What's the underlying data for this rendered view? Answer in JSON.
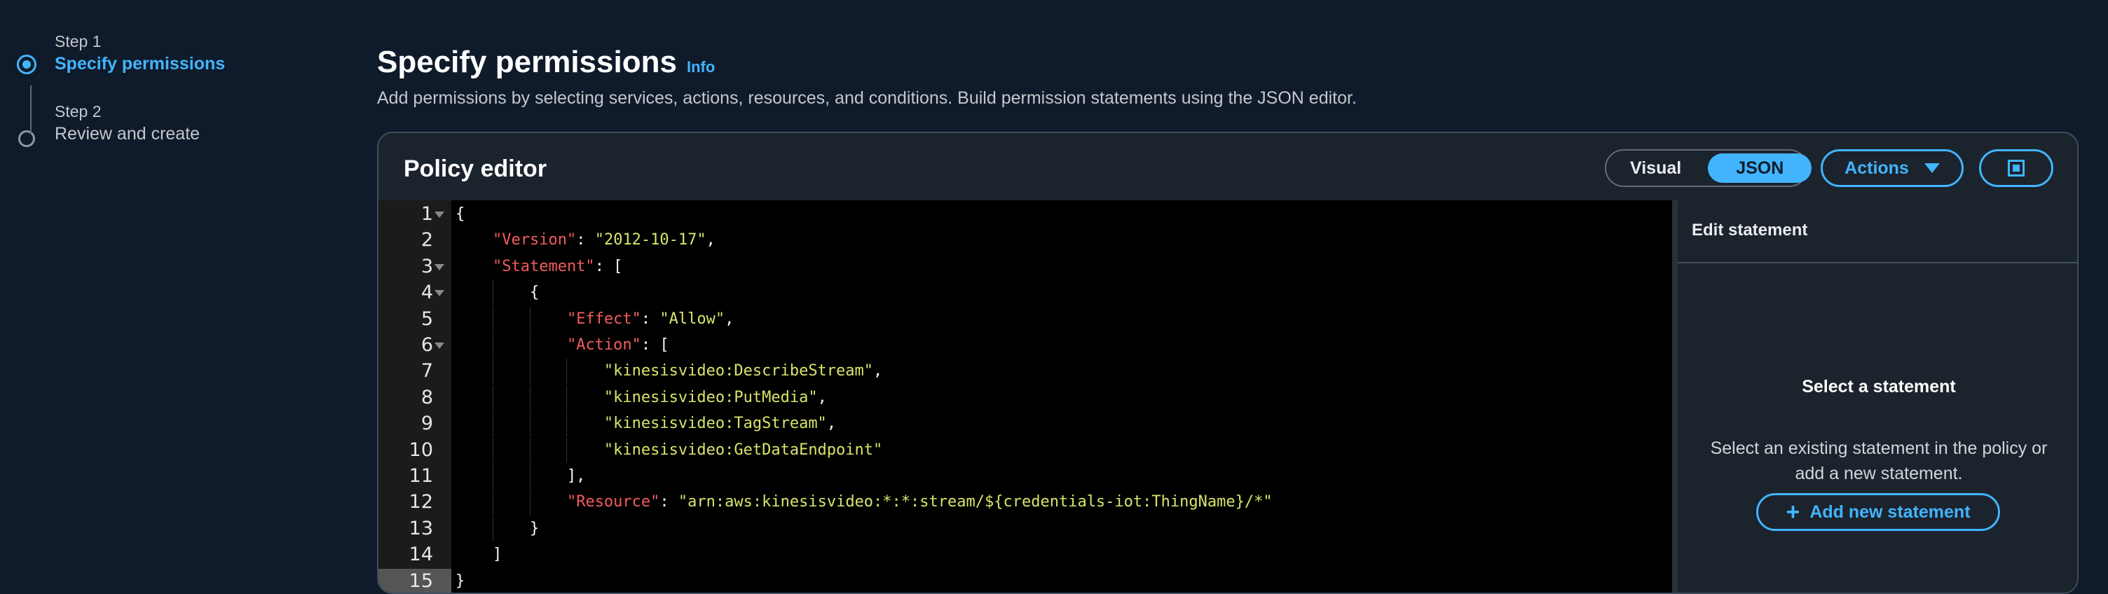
{
  "steps": [
    {
      "sub": "Step 1",
      "title": "Specify permissions",
      "active": true
    },
    {
      "sub": "Step 2",
      "title": "Review and create",
      "active": false
    }
  ],
  "header": {
    "title": "Specify permissions",
    "info": "Info",
    "description": "Add permissions by selecting services, actions, resources, and conditions. Build permission statements using the JSON editor."
  },
  "editor": {
    "title": "Policy editor",
    "mode_options": [
      "Visual",
      "JSON"
    ],
    "selected_mode": "JSON",
    "actions_label": "Actions",
    "fullscreen_icon": "fullscreen-icon",
    "active_line": 15,
    "code_lines": [
      {
        "n": "1",
        "text": "{"
      },
      {
        "n": "2",
        "text": "    \"Version\": \"2012-10-17\","
      },
      {
        "n": "3",
        "text": "    \"Statement\": ["
      },
      {
        "n": "4",
        "text": "        {"
      },
      {
        "n": "5",
        "text": "            \"Effect\": \"Allow\","
      },
      {
        "n": "6",
        "text": "            \"Action\": ["
      },
      {
        "n": "7",
        "text": "                \"kinesisvideo:DescribeStream\","
      },
      {
        "n": "8",
        "text": "                \"kinesisvideo:PutMedia\","
      },
      {
        "n": "9",
        "text": "                \"kinesisvideo:TagStream\","
      },
      {
        "n": "10",
        "text": "                \"kinesisvideo:GetDataEndpoint\""
      },
      {
        "n": "11",
        "text": "            ],"
      },
      {
        "n": "12",
        "text": "            \"Resource\": \"arn:aws:kinesisvideo:*:*:stream/${credentials-iot:ThingName}/*\""
      },
      {
        "n": "13",
        "text": "        }"
      },
      {
        "n": "14",
        "text": "    ]"
      },
      {
        "n": "15",
        "text": "}"
      }
    ]
  },
  "side_panel": {
    "title": "Edit statement",
    "empty_title": "Select a statement",
    "empty_description": "Select an existing statement in the policy or add a new statement.",
    "add_button": "Add new statement"
  },
  "colors": {
    "accent": "#42b4ff",
    "json_key": "#f35b5b",
    "json_string": "#d9e46a"
  }
}
